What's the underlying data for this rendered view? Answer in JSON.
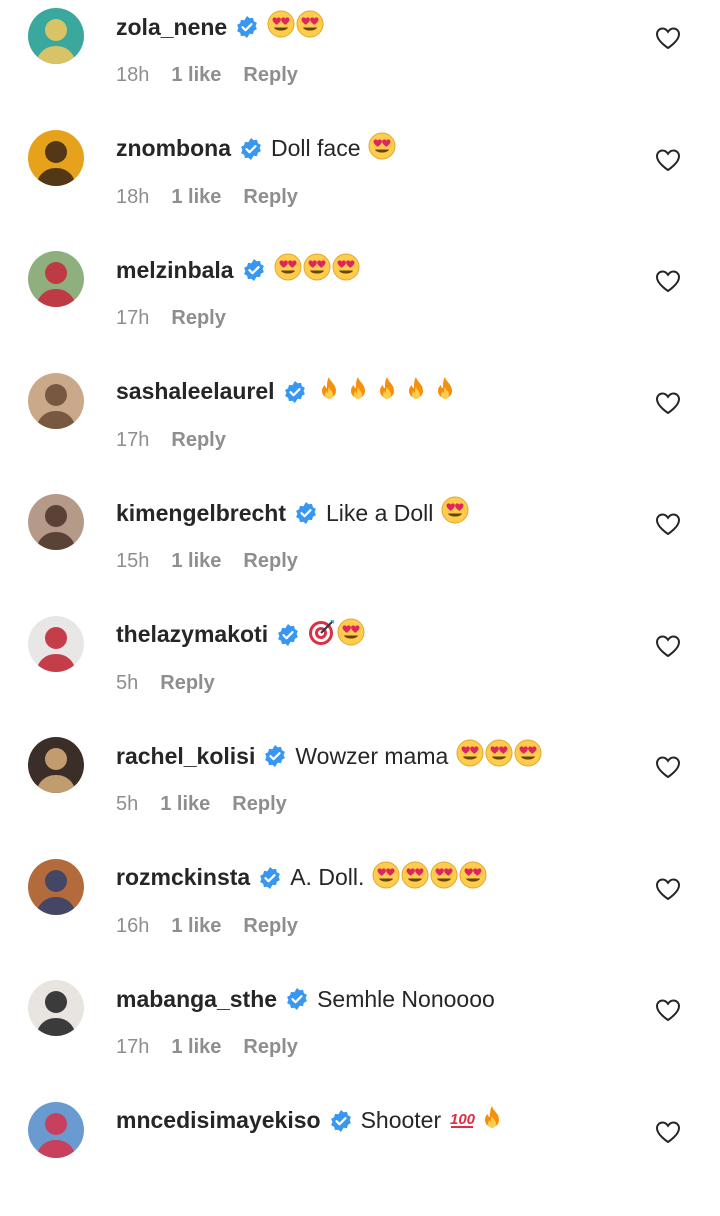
{
  "comments": [
    {
      "username": "zola_nene",
      "text": "",
      "emoji": [
        "heart-eyes",
        "heart-eyes"
      ],
      "time": "18h",
      "likes": "1 like",
      "reply": "Reply",
      "avatar_bg": "#3aa89c",
      "avatar_fg": "#f4c95d"
    },
    {
      "username": "znombona",
      "text": "Doll face",
      "emoji": [
        "heart-eyes"
      ],
      "time": "18h",
      "likes": "1 like",
      "reply": "Reply",
      "avatar_bg": "#e6a21b",
      "avatar_fg": "#3a2416"
    },
    {
      "username": "melzinbala",
      "text": "",
      "emoji": [
        "heart-eyes",
        "heart-eyes",
        "heart-eyes"
      ],
      "time": "17h",
      "likes": "",
      "reply": "Reply",
      "avatar_bg": "#8fb07e",
      "avatar_fg": "#c7263a"
    },
    {
      "username": "sashaleelaurel",
      "text": "",
      "emoji": [
        "fire",
        "fire",
        "fire",
        "fire",
        "fire"
      ],
      "time": "17h",
      "likes": "",
      "reply": "Reply",
      "avatar_bg": "#c9a98a",
      "avatar_fg": "#6b4a35"
    },
    {
      "username": "kimengelbrecht",
      "text": "Like a Doll",
      "emoji": [
        "heart-eyes"
      ],
      "time": "15h",
      "likes": "1 like",
      "reply": "Reply",
      "avatar_bg": "#b59a8a",
      "avatar_fg": "#4a3328"
    },
    {
      "username": "thelazymakoti",
      "text": "",
      "emoji": [
        "target",
        "heart-eyes"
      ],
      "time": "5h",
      "likes": "",
      "reply": "Reply",
      "avatar_bg": "#e9e6e6",
      "avatar_fg": "#c01e2e"
    },
    {
      "username": "rachel_kolisi",
      "text": "Wowzer mama",
      "emoji": [
        "heart-eyes",
        "heart-eyes",
        "heart-eyes"
      ],
      "time": "5h",
      "likes": "1 like",
      "reply": "Reply",
      "avatar_bg": "#3b2d28",
      "avatar_fg": "#d9b07a"
    },
    {
      "username": "rozmckinsta",
      "text": "A. Doll.",
      "emoji": [
        "heart-eyes",
        "heart-eyes",
        "heart-eyes",
        "heart-eyes"
      ],
      "time": "16h",
      "likes": "1 like",
      "reply": "Reply",
      "avatar_bg": "#b46b3c",
      "avatar_fg": "#2f3f6b"
    },
    {
      "username": "mabanga_sthe",
      "text": "Semhle Nonoooo",
      "emoji": [],
      "time": "17h",
      "likes": "1 like",
      "reply": "Reply",
      "avatar_bg": "#e8e4e0",
      "avatar_fg": "#1d1d1d"
    },
    {
      "username": "mncedisimayekiso",
      "text": "Shooter",
      "emoji": [
        "hundred",
        "fire"
      ],
      "time": "",
      "likes": "",
      "reply": "",
      "avatar_bg": "#6a9bd0",
      "avatar_fg": "#d9304a"
    }
  ],
  "colors": {
    "verified": "#3897f0",
    "secondary_text": "#8e8e8e",
    "primary_text": "#262626"
  }
}
